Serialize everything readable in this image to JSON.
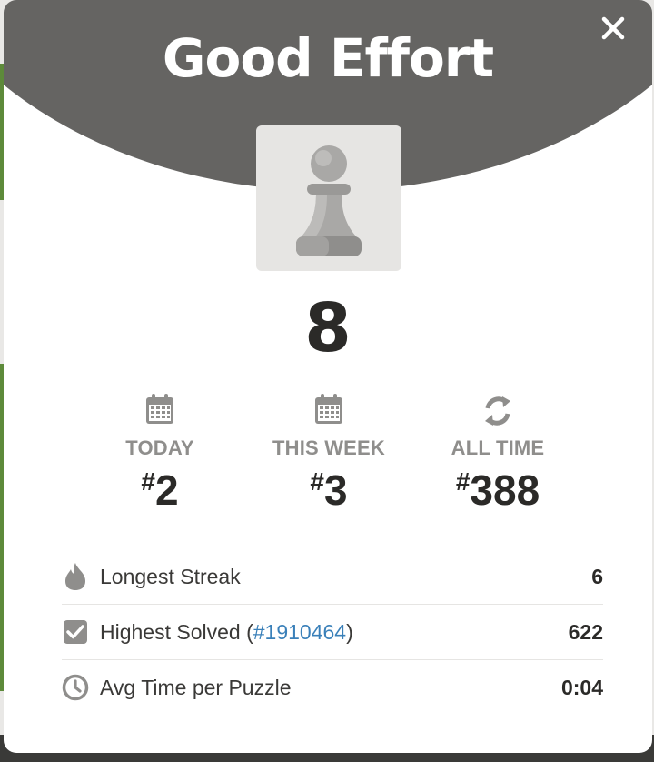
{
  "modal": {
    "title": "Good Effort",
    "close_icon": "close-icon",
    "piece_icon": "pawn-icon",
    "score": "8"
  },
  "ranks": [
    {
      "icon": "calendar-icon",
      "label": "TODAY",
      "hash": "#",
      "value": "2"
    },
    {
      "icon": "calendar-icon",
      "label": "THIS WEEK",
      "hash": "#",
      "value": "3"
    },
    {
      "icon": "refresh-icon",
      "label": "ALL TIME",
      "hash": "#",
      "value": "388"
    }
  ],
  "stats": {
    "longest_streak": {
      "icon": "flame-icon",
      "label": "Longest Streak",
      "value": "6"
    },
    "highest_solved": {
      "icon": "checkbox-icon",
      "label": "Highest Solved (",
      "link": "#1910464",
      "label_end": ")",
      "value": "622"
    },
    "avg_time": {
      "icon": "clock-icon",
      "label": "Avg Time per Puzzle",
      "value": "0:04"
    }
  },
  "colors": {
    "header": "#656462",
    "link": "#3a80b9",
    "muted": "#8f8e8c",
    "text": "#2b2a28"
  }
}
